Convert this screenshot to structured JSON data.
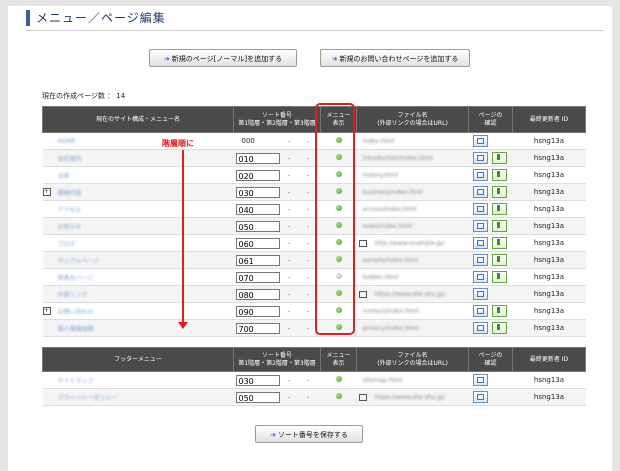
{
  "page_title": "メニュー／ページ編集",
  "buttons": {
    "add_page": "新規のページ[ノーマル]を追加する",
    "add_contact": "新規のお問い合わせページを追加する",
    "save_sort": "ソート番号を保存する"
  },
  "page_count_label": "現在の作成ページ数 ： 14",
  "main_table": {
    "headers": {
      "name": "現在のサイト構成・メニュー名",
      "sort_line1": "ソート番号",
      "sort_line2": "第1階層・第2階層・第3階層",
      "menu_line1": "メニュー",
      "menu_line2": "表示",
      "file_line1": "ファイル名",
      "file_line2": "(外部リンクの場合はURL)",
      "page_line1": "ページの",
      "page_line2": "確認",
      "updater": "最終更新者 ID"
    },
    "rows": [
      {
        "name": "HOME",
        "expand": false,
        "sort": "000",
        "input": false,
        "menu_on": true,
        "file": "index.html",
        "ext": false,
        "preview": true,
        "edit": false,
        "updater": "hsng13a"
      },
      {
        "name": "会社案内",
        "expand": false,
        "sort": "010",
        "input": true,
        "menu_on": true,
        "file": "introduction/index.html",
        "ext": false,
        "preview": true,
        "edit": true,
        "updater": "hsng13a"
      },
      {
        "name": "沿革",
        "expand": false,
        "sort": "020",
        "input": true,
        "menu_on": true,
        "file": "history.html",
        "ext": false,
        "preview": true,
        "edit": true,
        "updater": "hsng13a"
      },
      {
        "name": "業務内容",
        "expand": true,
        "sort": "030",
        "input": true,
        "menu_on": true,
        "file": "business/index.html",
        "ext": false,
        "preview": true,
        "edit": true,
        "updater": "hsng13a"
      },
      {
        "name": "アクセス",
        "expand": false,
        "sort": "040",
        "input": true,
        "menu_on": true,
        "file": "access/index.html",
        "ext": false,
        "preview": true,
        "edit": true,
        "updater": "hsng13a"
      },
      {
        "name": "お知らせ",
        "expand": false,
        "sort": "050",
        "input": true,
        "menu_on": true,
        "file": "news/index.html",
        "ext": false,
        "preview": true,
        "edit": true,
        "updater": "hsng13a"
      },
      {
        "name": "ブログ",
        "expand": false,
        "sort": "060",
        "input": true,
        "menu_on": true,
        "file": "http://www.example.jp/",
        "ext": true,
        "preview": true,
        "edit": true,
        "updater": "hsng13a"
      },
      {
        "name": "サンプルページ",
        "expand": false,
        "sort": "061",
        "input": true,
        "menu_on": true,
        "file": "sample/index.html",
        "ext": false,
        "preview": true,
        "edit": true,
        "updater": "hsng13a"
      },
      {
        "name": "非表示ページ",
        "expand": false,
        "sort": "070",
        "input": true,
        "menu_on": false,
        "file": "hidden.html",
        "ext": false,
        "preview": true,
        "edit": true,
        "updater": "hsng13a"
      },
      {
        "name": "外部リンク",
        "expand": false,
        "sort": "080",
        "input": true,
        "menu_on": true,
        "file": "https://www.sho-shu.jp/",
        "ext": true,
        "preview": true,
        "edit": false,
        "updater": "hsng13a"
      },
      {
        "name": "お問い合わせ",
        "expand": true,
        "sort": "090",
        "input": true,
        "menu_on": true,
        "file": "contact/index.html",
        "ext": false,
        "preview": true,
        "edit": true,
        "updater": "hsng13a"
      },
      {
        "name": "個人情報保護",
        "expand": false,
        "sort": "700",
        "input": true,
        "menu_on": true,
        "file": "privacy/index.html",
        "ext": false,
        "preview": true,
        "edit": true,
        "updater": "hsng13a"
      }
    ]
  },
  "footer_table": {
    "headers": {
      "name": "フッターメニュー",
      "sort_line1": "ソート番号",
      "sort_line2": "第1階層・第2階層・第3階層",
      "menu_line1": "メニュー",
      "menu_line2": "表示",
      "file_line1": "ファイル名",
      "file_line2": "(外部リンクの場合はURL)",
      "page_line1": "ページの",
      "page_line2": "確認",
      "updater": "最終更新者 ID"
    },
    "rows": [
      {
        "name": "サイトマップ",
        "expand": false,
        "sort": "030",
        "input": true,
        "menu_on": true,
        "file": "sitemap.html",
        "ext": false,
        "preview": true,
        "edit": false,
        "updater": "hsng13a"
      },
      {
        "name": "プライバシーポリシー",
        "expand": false,
        "sort": "050",
        "input": true,
        "menu_on": true,
        "file": "https://www.sho-shu.jp/",
        "ext": true,
        "preview": true,
        "edit": false,
        "updater": "hsng13a"
      }
    ]
  },
  "annotation": {
    "text": "階層順に",
    "color": "#e02020"
  }
}
